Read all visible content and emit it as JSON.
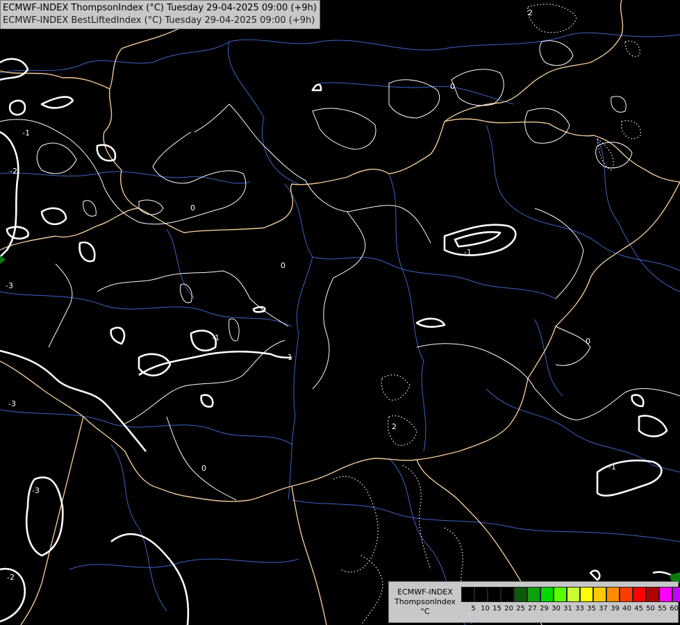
{
  "header": {
    "line1": "ECMWF-INDEX ThompsonIndex (°C) Tuesday 29-04-2025 09:00 (+9h)",
    "line2": "ECMWF-INDEX BestLiftedIndex (°C) Tuesday 29-04-2025 09:00 (+9h)"
  },
  "legend": {
    "model": "ECMWF-INDEX",
    "index": "ThompsonIndex",
    "unit": "°C",
    "ticks": [
      "5",
      "10",
      "15",
      "20",
      "25",
      "27",
      "29",
      "30",
      "31",
      "33",
      "35",
      "37",
      "39",
      "40",
      "45",
      "50",
      "55",
      "60"
    ],
    "colors": [
      "#000000",
      "#000000",
      "#000000",
      "#000000",
      "#0a5a0a",
      "#0fa00f",
      "#00d800",
      "#5aff00",
      "#c8ff32",
      "#ffff00",
      "#ffc800",
      "#ff8c00",
      "#ff3c00",
      "#ff0000",
      "#b00000",
      "#ff00ff",
      "#c800ff",
      "#7800ff",
      "#0000ff"
    ]
  },
  "contour_labels": [
    "-1",
    "-2",
    "-3",
    "-3",
    "-3",
    "-2",
    "0",
    "0",
    "-1",
    "-1",
    "0",
    "-1",
    "0",
    "2",
    "2",
    "0",
    "-1"
  ],
  "colors": {
    "background": "#000000",
    "border": "#f0c896",
    "river": "#3c64c8",
    "contour": "#ffffff"
  }
}
